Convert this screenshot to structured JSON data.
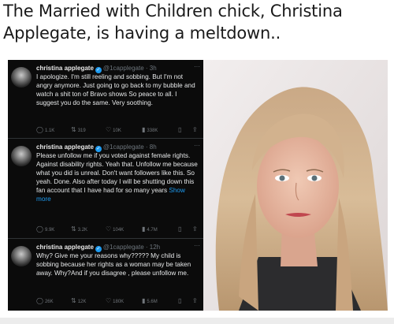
{
  "headline": "The Married with Children chick, Christina Applegate, is having a meltdown..",
  "tweets": [
    {
      "name": "christina applegate",
      "handle": "@1capplegate",
      "time": "3h",
      "text": "I apologize. I'm still reeling and sobbing. But I'm not angry anymore. Just going to go back to my bubble and watch a shit ton of Bravo shows So peace to all. I suggest you do the same. Very soothing.",
      "replies": "1.1K",
      "retweets": "319",
      "likes": "10K",
      "views": "338K"
    },
    {
      "name": "christina applegate",
      "handle": "@1capplegate",
      "time": "8h",
      "text": "Please unfollow me if you voted against female rights. Against disability rights. Yeah that. Unfollow me because what you did is unreal. Don't want followers like this. So yeah. Done. Also after today I will be shutting down this fan account that I have had for so many years",
      "show_more": "Show more",
      "replies": "9.9K",
      "retweets": "3.2K",
      "likes": "104K",
      "views": "4.7M"
    },
    {
      "name": "christina applegate",
      "handle": "@1capplegate",
      "time": "12h",
      "text": "Why? Give me your reasons why????? My child is sobbing because her rights as a woman may be taken away. Why?And if you disagree , please unfollow me.",
      "replies": "26K",
      "retweets": "12K",
      "likes": "180K",
      "views": "5.6M"
    }
  ],
  "icons": {
    "verified": "verified-badge-icon",
    "reply": "reply-icon",
    "retweet": "retweet-icon",
    "like": "heart-icon",
    "views": "views-chart-icon",
    "bookmark": "bookmark-icon",
    "share": "share-icon",
    "more": "more-dots-icon"
  },
  "colors": {
    "tweet_background": "#0b0b0b",
    "link": "#1d9bf0",
    "verified": "#1d9bf0",
    "muted": "#6e767d"
  }
}
